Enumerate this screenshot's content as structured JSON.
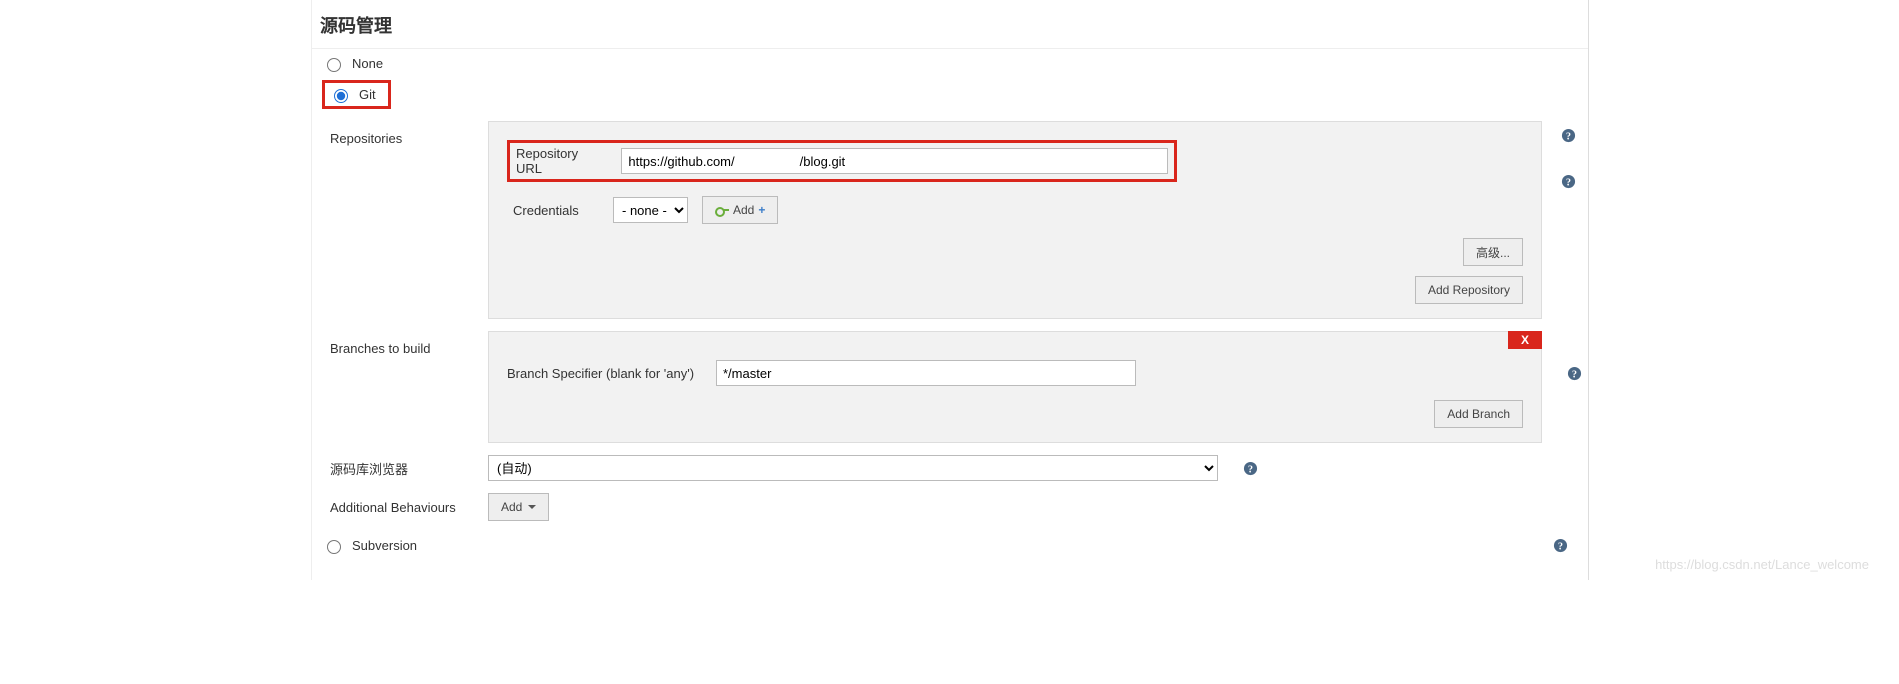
{
  "section": {
    "title": "源码管理"
  },
  "scm": {
    "none_label": "None",
    "git_label": "Git",
    "svn_label": "Subversion",
    "selected": "git"
  },
  "repositories": {
    "label": "Repositories",
    "url_label": "Repository URL",
    "url_value": "https://github.com/                  /blog.git",
    "credentials_label": "Credentials",
    "credentials_options": [
      "- none -"
    ],
    "add_button": "Add",
    "advanced_button": "高级...",
    "add_repo_button": "Add Repository"
  },
  "branches": {
    "label": "Branches to build",
    "specifier_label": "Branch Specifier (blank for 'any')",
    "specifier_value": "*/master",
    "add_branch_button": "Add Branch",
    "remove_x": "X"
  },
  "browser": {
    "label": "源码库浏览器",
    "options": [
      "(自动)"
    ]
  },
  "behaviours": {
    "label": "Additional Behaviours",
    "add_button": "Add"
  },
  "watermark": "https://blog.csdn.net/Lance_welcome"
}
